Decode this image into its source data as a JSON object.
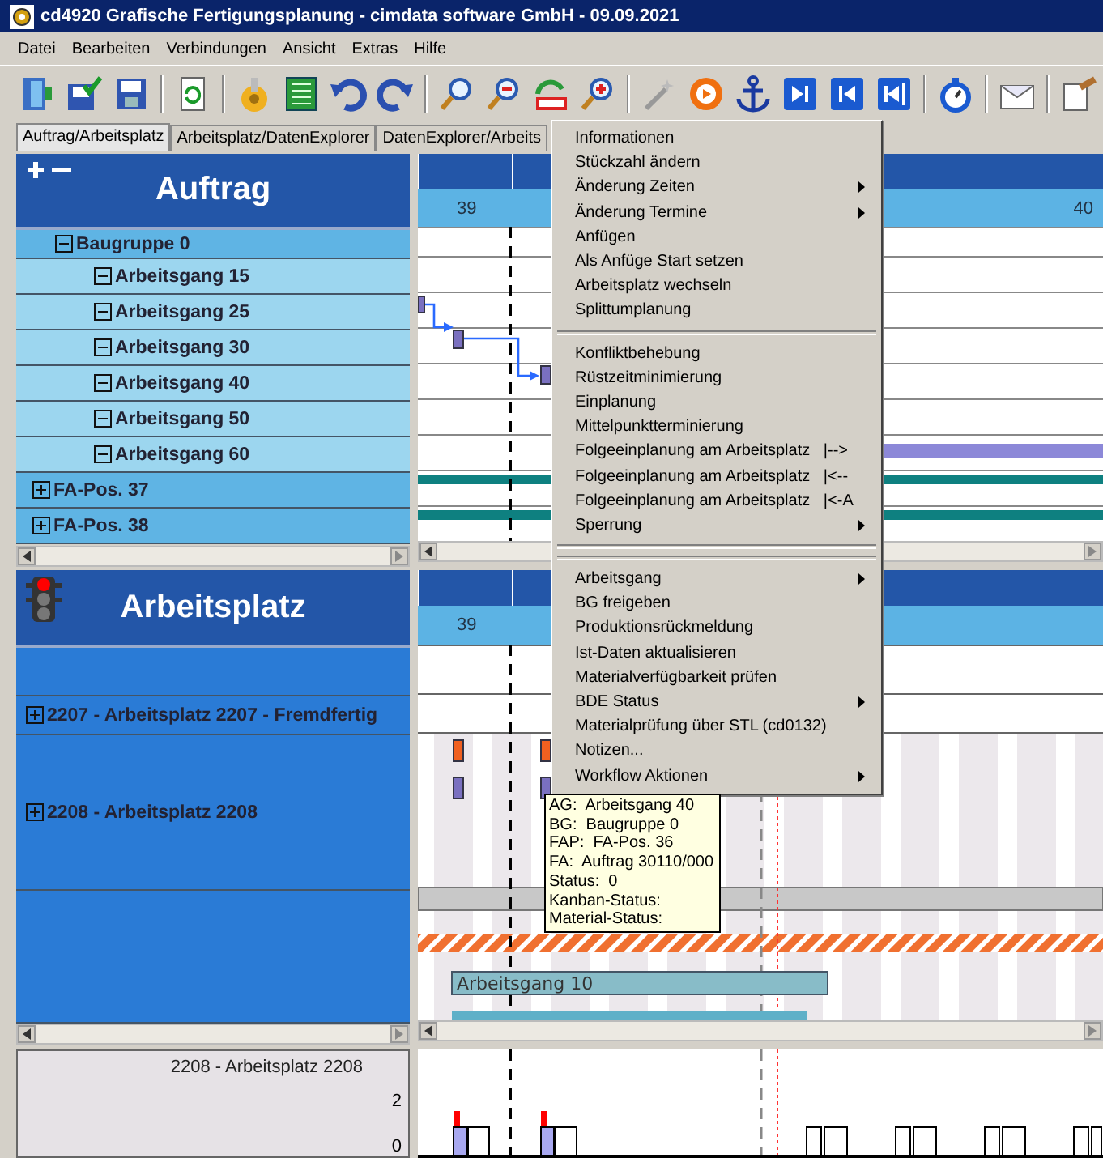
{
  "window": {
    "title": "cd4920 Grafische Fertigungsplanung - cimdata software GmbH - 09.09.2021"
  },
  "menu": [
    "Datei",
    "Bearbeiten",
    "Verbindungen",
    "Ansicht",
    "Extras",
    "Hilfe"
  ],
  "tabs": [
    {
      "label": "Auftrag/Arbeitsplatz",
      "selected": true
    },
    {
      "label": "Arbeitsplatz/DatenExplorer",
      "selected": false
    },
    {
      "label": "DatenExplorer/Arbeits",
      "selected": false
    }
  ],
  "order_panel": {
    "title": "Auftrag",
    "weeks": [
      "39",
      "40"
    ],
    "rows": [
      {
        "label": "Baugruppe 0",
        "kind": "group",
        "expanded": true
      },
      {
        "label": "Arbeitsgang 15",
        "kind": "operation",
        "expanded": true
      },
      {
        "label": "Arbeitsgang 25",
        "kind": "operation",
        "expanded": true
      },
      {
        "label": "Arbeitsgang 30",
        "kind": "operation",
        "expanded": true
      },
      {
        "label": "Arbeitsgang 40",
        "kind": "operation",
        "expanded": true
      },
      {
        "label": "Arbeitsgang 50",
        "kind": "operation",
        "expanded": true
      },
      {
        "label": "Arbeitsgang 60",
        "kind": "operation",
        "expanded": true
      },
      {
        "label": "FA-Pos. 37",
        "kind": "position",
        "expanded": false
      },
      {
        "label": "FA-Pos. 38",
        "kind": "position",
        "expanded": false
      }
    ]
  },
  "workcenter_panel": {
    "title": "Arbeitsplatz",
    "weeks": [
      "39"
    ],
    "rows": [
      {
        "kind": "blank"
      },
      {
        "label": "2207 - Arbeitsplatz 2207 - Fremdfertig",
        "kind": "workcenter",
        "expanded": false
      },
      {
        "label": "2208 - Arbeitsplatz 2208",
        "kind": "workcenter",
        "expanded": false
      },
      {
        "kind": "blank"
      }
    ],
    "bars": [
      {
        "label": "Arbeitsgang 10"
      }
    ]
  },
  "load_panel": {
    "title": "2208 - Arbeitsplatz 2208",
    "axis_labels": [
      "2",
      "0"
    ]
  },
  "context_menu": {
    "items": [
      {
        "kind": "item",
        "label": "Informationen",
        "submenu": false
      },
      {
        "kind": "item",
        "label": "Stückzahl ändern",
        "submenu": false
      },
      {
        "kind": "item",
        "label": "Änderung Zeiten",
        "submenu": true
      },
      {
        "kind": "item",
        "label": "Änderung Termine",
        "submenu": true
      },
      {
        "kind": "item",
        "label": "Anfügen",
        "submenu": false
      },
      {
        "kind": "item",
        "label": "Als Anfüge Start setzen",
        "submenu": false
      },
      {
        "kind": "item",
        "label": "Arbeitsplatz wechseln",
        "submenu": false
      },
      {
        "kind": "item",
        "label": "Splittumplanung",
        "submenu": false
      },
      {
        "kind": "separator"
      },
      {
        "kind": "item",
        "label": "Konfliktbehebung",
        "submenu": false
      },
      {
        "kind": "item",
        "label": "Rüstzeitminimierung",
        "submenu": false
      },
      {
        "kind": "item",
        "label": "Einplanung",
        "submenu": false
      },
      {
        "kind": "item",
        "label": "Mittelpunktterminierung",
        "submenu": false
      },
      {
        "kind": "item",
        "label": "Folgeeinplanung am Arbeitsplatz   |-->",
        "submenu": false
      },
      {
        "kind": "item",
        "label": "Folgeeinplanung am Arbeitsplatz   |<--",
        "submenu": false
      },
      {
        "kind": "item",
        "label": "Folgeeinplanung am Arbeitsplatz   |<-A",
        "submenu": false
      },
      {
        "kind": "item",
        "label": "Sperrung",
        "submenu": true
      },
      {
        "kind": "separator"
      },
      {
        "kind": "separator"
      },
      {
        "kind": "item",
        "label": "Arbeitsgang",
        "submenu": true
      },
      {
        "kind": "item",
        "label": "BG freigeben",
        "submenu": false
      },
      {
        "kind": "item",
        "label": "Produktionsrückmeldung",
        "submenu": false
      },
      {
        "kind": "item",
        "label": "Ist-Daten aktualisieren",
        "submenu": false
      },
      {
        "kind": "item",
        "label": "Materialverfügbarkeit prüfen",
        "submenu": false
      },
      {
        "kind": "item",
        "label": "BDE Status",
        "submenu": true
      },
      {
        "kind": "item",
        "label": "Materialprüfung über STL (cd0132)",
        "submenu": false
      },
      {
        "kind": "item",
        "label": "Notizen...",
        "submenu": false
      },
      {
        "kind": "item",
        "label": "Workflow Aktionen",
        "submenu": true
      }
    ]
  },
  "tooltip": {
    "lines": [
      "AG:  Arbeitsgang 40",
      "BG:  Baugruppe 0",
      "FAP:  FA-Pos. 36",
      "FA:  Auftrag 30110/000",
      "Status:  0",
      "Kanban-Status:",
      "Material-Status:"
    ]
  }
}
